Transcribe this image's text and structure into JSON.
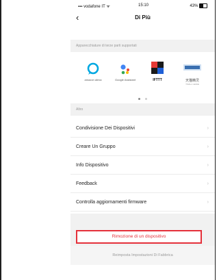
{
  "status_bar": {
    "carrier": "vodafone IT",
    "time": "15:10",
    "battery": "43%"
  },
  "header": {
    "back_icon": "chevron-left-icon",
    "title": "Di Più"
  },
  "partners": {
    "header": "Apparecchiature di terze parti supportati",
    "items": [
      {
        "label": "amazon alexa",
        "icon": "alexa-ring-icon",
        "color": "#00a8e1"
      },
      {
        "label": "Google Assistant",
        "icon": "google-assistant-dots-icon",
        "color": "#4285f4"
      },
      {
        "label": "IFTTT",
        "icon": "ifttt-logo-icon",
        "color": "#1a1a1a"
      },
      {
        "label": "天猫精灵",
        "sublabel": "TMALL GENIE",
        "icon": "tmall-genie-icon",
        "color": "#3a6fb0"
      }
    ],
    "page_dots": 2,
    "active_dot": 1
  },
  "other": {
    "header": "Altro",
    "items": [
      {
        "label": "Condivisione Dei Dispositivi"
      },
      {
        "label": "Creare Un Gruppo"
      },
      {
        "label": "Info Dispositivo"
      },
      {
        "label": "Feedback"
      },
      {
        "label": "Controlla aggiornamenti firmware"
      }
    ]
  },
  "actions": {
    "remove_label": "Rimozione di un dispositivo",
    "reset_label": "Reimposta Impostazioni Di Fabbrica"
  },
  "colors": {
    "accent_red": "#e5303a",
    "section_bg": "#f1f1f1"
  }
}
